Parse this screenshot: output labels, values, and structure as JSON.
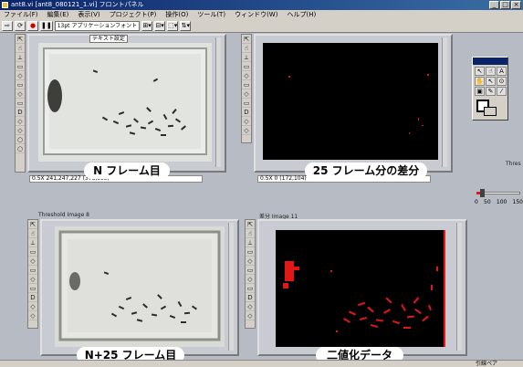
{
  "window": {
    "title": "ant8.vi [ant8_080121_1.vi] フロントパネル",
    "controls": [
      "_",
      "□",
      "×"
    ]
  },
  "menu": [
    "ファイル(F)",
    "編集(E)",
    "表示(V)",
    "プロジェクト(P)",
    "操作(O)",
    "ツール(T)",
    "ウィンドウ(W)",
    "ヘルプ(H)"
  ],
  "toolbar": {
    "run": "⇨",
    "run_continuous": "⟳",
    "abort": "●",
    "pause": "❚❚",
    "font": "13pt アプリケーションフォント",
    "align": "⊞▾",
    "distribute": "⊟▾",
    "resize": "⬚▾",
    "reorder": "⇅▾"
  },
  "palette_tools": [
    "⇱",
    "☝",
    "⟂",
    "▭",
    "◇",
    "▭",
    "◇",
    "▭",
    "D",
    "◇",
    "◇",
    "○",
    "○",
    "☊"
  ],
  "panels": {
    "p1": {
      "tag": "テキスト設定",
      "readout": "0.5X 241,247,227     (378,ooo)",
      "caption": "N フレーム目"
    },
    "p2": {
      "readout": "0.5X 0     (172,104)",
      "caption": "25 フレーム分の差分"
    },
    "p3": {
      "label": "Threshold Image 8",
      "caption": "N+25 フレーム目"
    },
    "p4": {
      "label": "差分 Image 11",
      "caption": "二値化データ"
    }
  },
  "right_label": "Thres",
  "slider": {
    "ticks": [
      "0",
      "50",
      "100",
      "150"
    ],
    "value": 20,
    "max": 150
  },
  "tools_window": [
    "↖",
    "☝",
    "A",
    "✋",
    "↖",
    "⊙",
    "▣",
    "✎",
    "⁄"
  ],
  "status_text": "引線ペア",
  "colors": {
    "diff_red": "#e21818",
    "black": "#000000",
    "titlebar": "#0a246a"
  }
}
